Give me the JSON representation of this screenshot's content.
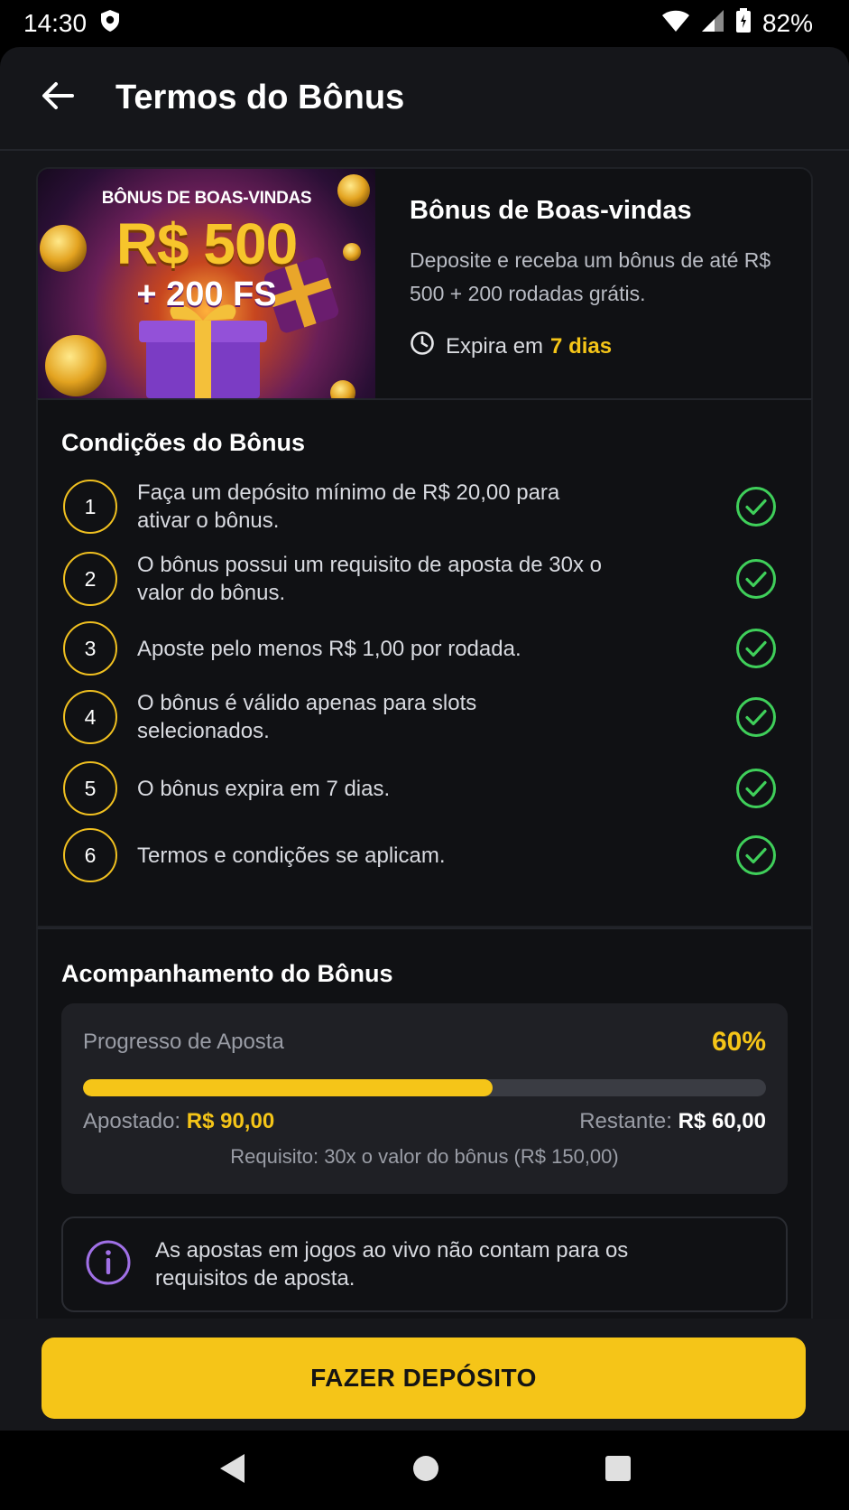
{
  "status_bar": {
    "time": "14:30",
    "battery": "82%"
  },
  "header": {
    "title": "Termos do Bônus"
  },
  "hero": {
    "banner_line1": "BÔNUS DE BOAS-VINDAS",
    "banner_line2": "R$ 500",
    "banner_line3": "+ 200 FS",
    "title": "Bônus de Boas-vindas",
    "description": "Deposite e receba um bônus de até R$ 500 + 200 rodadas grátis.",
    "expiry_label": "Expira em",
    "expiry_value": "7 dias"
  },
  "conditions": {
    "title": "Condições do Bônus",
    "items": [
      {
        "num": "1",
        "text": "Faça um depósito mínimo de R$ 20,00 para ativar o bônus.",
        "done": true
      },
      {
        "num": "2",
        "text": "O bônus possui um requisito de aposta de 30x o valor do bônus.",
        "done": true
      },
      {
        "num": "3",
        "text": "Aposte pelo menos R$ 1,00 por rodada.",
        "done": true
      },
      {
        "num": "4",
        "text": "O bônus é válido apenas para slots selecionados.",
        "done": true
      },
      {
        "num": "5",
        "text": "O bônus expira em 7 dias.",
        "done": true
      },
      {
        "num": "6",
        "text": "Termos e condições se aplicam.",
        "done": true
      }
    ]
  },
  "tracking": {
    "title": "Acompanhamento do Bônus",
    "progress_label": "Progresso de Aposta",
    "progress_percent": "60%",
    "progress_fraction": 0.6,
    "wagered_label": "Apostado:",
    "wagered_value": "R$ 90,00",
    "remaining_label": "Restante:",
    "remaining_value": "R$ 60,00",
    "requirement": "Requisito: 30x o valor do bônus (R$ 150,00)"
  },
  "info": {
    "text": "As apostas em jogos ao vivo não contam para os requisitos de aposta."
  },
  "cta": {
    "label": "FAZER DEPÓSITO"
  },
  "colors": {
    "accent": "#f5c518",
    "success": "#3fcf5a",
    "info": "#a070e6",
    "background": "#15161a"
  }
}
